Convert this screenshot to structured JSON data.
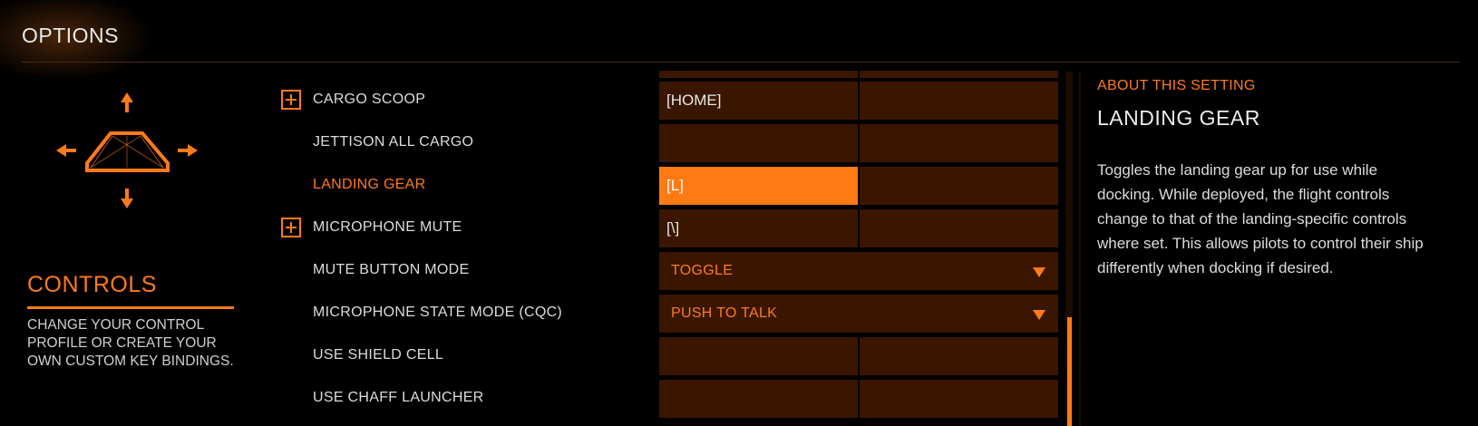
{
  "header": {
    "title": "OPTIONS"
  },
  "sidebar": {
    "heading": "CONTROLS",
    "description": "CHANGE YOUR CONTROL PROFILE OR CREATE YOUR OWN CUSTOM KEY BINDINGS."
  },
  "bindings": [
    {
      "label": "CARGO SCOOP",
      "expandable": true,
      "primary": "[HOME]",
      "secondary": ""
    },
    {
      "label": "JETTISON ALL CARGO",
      "expandable": false,
      "primary": "",
      "secondary": ""
    },
    {
      "label": "LANDING GEAR",
      "expandable": false,
      "primary": "[L]",
      "secondary": "",
      "selected": true
    },
    {
      "label": "MICROPHONE MUTE",
      "expandable": true,
      "primary": "[\\]",
      "secondary": ""
    },
    {
      "label": "MUTE BUTTON MODE",
      "expandable": false,
      "select_value": "TOGGLE"
    },
    {
      "label": "MICROPHONE STATE MODE (CQC)",
      "expandable": false,
      "select_value": "PUSH TO TALK"
    },
    {
      "label": "USE SHIELD CELL",
      "expandable": false,
      "primary": "",
      "secondary": ""
    },
    {
      "label": "USE CHAFF LAUNCHER",
      "expandable": false,
      "primary": "",
      "secondary": ""
    }
  ],
  "about": {
    "label": "ABOUT THIS SETTING",
    "title": "LANDING GEAR",
    "description": "Toggles the landing gear up for use while docking. While deployed, the flight controls change to that of the landing-specific controls where set. This allows pilots to control their ship differently when docking if desired."
  },
  "colors": {
    "accent": "#ff7a1a",
    "cell_background": "#3a1600",
    "page_background": "#000000"
  },
  "icons": {
    "ship": "ship-landing-icon",
    "expand": "plus-box-icon",
    "dropdown": "triangle-down-icon"
  }
}
